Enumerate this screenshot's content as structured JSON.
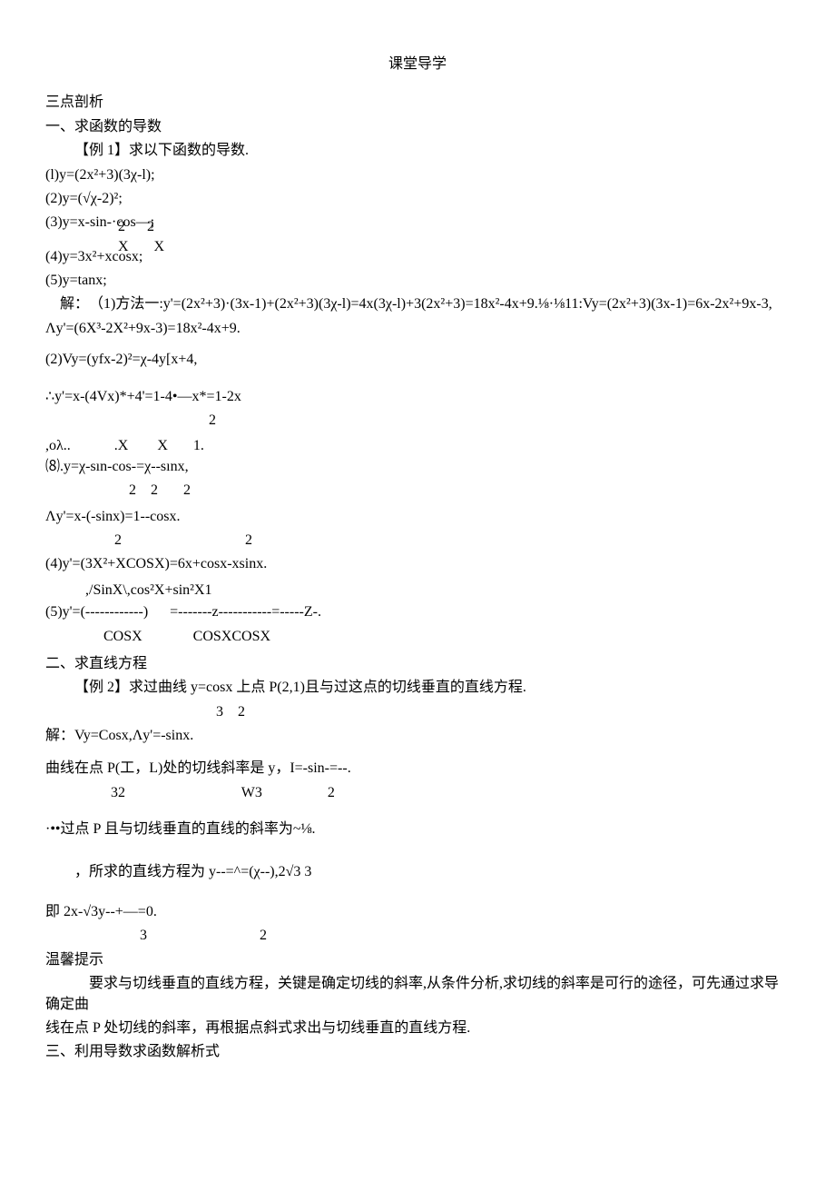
{
  "title": "课堂导学",
  "s1": "三点剖析",
  "s2": "一、求函数的导数",
  "s3": "【例 1】求以下函数的导数.",
  "l1": "(l)y=(2x²+3)(3χ-l);",
  "l2": "(2)y=(√χ-2)²;",
  "l3a": "(3)y=x-sin-·cos—;",
  "l3b_num": "X       X",
  "l3b_den": "2      2",
  "l4": "(4)y=3x²+xcosx;",
  "l5": "(5)y=tanx;",
  "sol_label": "解：",
  "sol1": "（1)方法一:y'=(2x²+3)·(3x-1)+(2x²+3)(3χ-l)=4x(3χ-l)+3(2x²+3)=18x²-4x+9.⅛·⅛11:Vy=(2x²+3)(3x-1)=6x-2x²+9x-3,",
  "sol1b": "Λy'=(6X³-2X²+9x-3)=18x²-4x+9.",
  "sol2": "(2)Vy=(yfx-2)²=χ-4y[x+4,",
  "sol2b": "∴y'=x-(4Vx)*+4'=1-4•—x*=1-2x",
  "sol2b_r": "2",
  "sol3_top": ",oλ..            .X        X       1.",
  "sol3_mid": "⑻.y=χ-sın-cos-=χ--sınx,",
  "sol3_bot": "2    2       2",
  "sol3b": "Λy'=x-(-sinx)=1--cosx.",
  "sol3b_l": "2",
  "sol3b_r": "2",
  "sol4": "(4)y'=(3X²+XCOSX)=6x+cosx-xsinx.",
  "sol5_top": ",/SinX\\,cos²X+sin²X1",
  "sol5_mid": "(5)y'=(------------)      =-------z-----------=-----Z-.",
  "sol5_bot": "COSX              COSXCOSX",
  "s4": "二、求直线方程",
  "ex2": "【例 2】求过曲线 y=cosx 上点 P(2,1)且与过这点的切线垂直的直线方程.",
  "ex2_den": "3    2",
  "ex2_sol": "解：Vy=Cosx,Λy'=-sinx.",
  "ex2_l1": "曲线在点 P(工，L)处的切线斜率是 y，I=-sin-=--.",
  "ex2_l1_den": "32                                W3                  2",
  "ex2_l2": "·••过点 P 且与切线垂直的直线的斜率为~⅛.",
  "ex2_l3": "，所求的直线方程为 y--=^=(χ--),2√3    3",
  "ex2_l4": "即 2x-√3y--+—=0.",
  "ex2_l4_den": "3                               2",
  "tip_h": "温馨提示",
  "tip1": "要求与切线垂直的直线方程，关键是确定切线的斜率,从条件分析,求切线的斜率是可行的途径，可先通过求导确定曲",
  "tip2": "线在点 P 处切线的斜率，再根据点斜式求出与切线垂直的直线方程.",
  "s5": "三、利用导数求函数解析式"
}
